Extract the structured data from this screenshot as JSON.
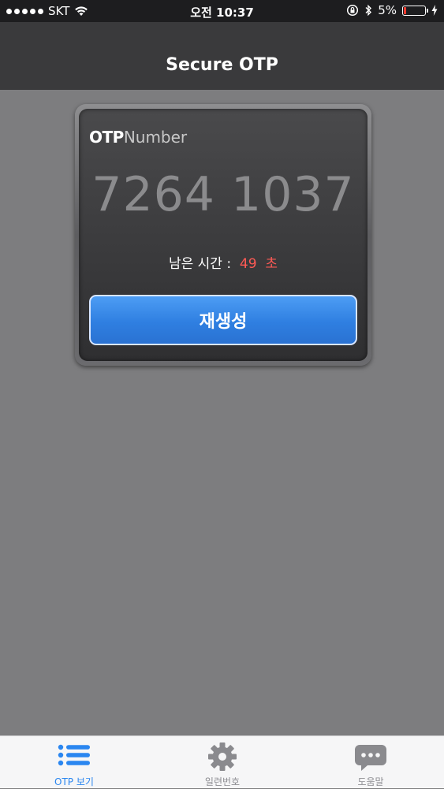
{
  "status_bar": {
    "carrier": "SKT",
    "time": "오전 10:37",
    "battery": "5%"
  },
  "nav": {
    "title": "Secure OTP"
  },
  "otp_card": {
    "label_bold": "OTP",
    "label_light": "Number",
    "otp_number": "7264 1037",
    "remaining_label": "남은 시간 :",
    "remaining_seconds": "49",
    "remaining_unit": "초",
    "regenerate_button": "재생성"
  },
  "tabs": [
    {
      "label": "OTP 보기",
      "icon": "list-icon",
      "active": true
    },
    {
      "label": "일련번호",
      "icon": "gear-icon",
      "active": false
    },
    {
      "label": "도움말",
      "icon": "chat-bubble-icon",
      "active": false
    }
  ],
  "colors": {
    "accent": "#2a86f0",
    "countdown": "#ff5a55",
    "battery_low": "#ff3b30"
  }
}
